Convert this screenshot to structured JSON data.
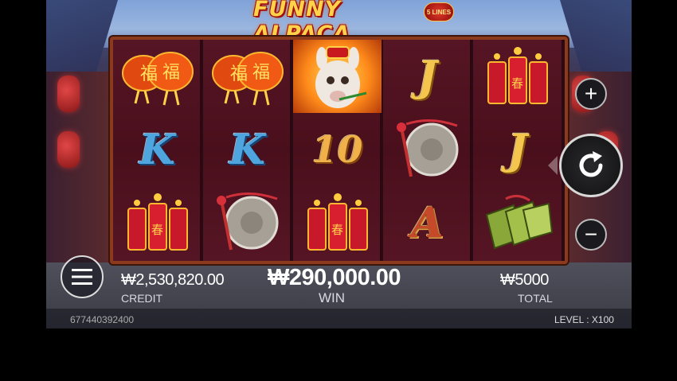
{
  "game": {
    "logo_text": "FUNNY ALPACA",
    "lines_badge": "5 LINES"
  },
  "reels": [
    [
      "lantern-fu",
      "letter-k",
      "firecrackers"
    ],
    [
      "lantern-fu",
      "letter-k",
      "gong"
    ],
    [
      "alpaca-wild",
      "number-10",
      "firecrackers"
    ],
    [
      "letter-j",
      "gong",
      "letter-a"
    ],
    [
      "firecrackers",
      "letter-j",
      "jade-tiles"
    ]
  ],
  "symbols": {
    "k_text": "K",
    "j_text": "J",
    "a_text": "A",
    "ten_text": "10",
    "fu_text": "福",
    "chun_text": "春"
  },
  "credit": {
    "value": "₩2,530,820.00",
    "caption": "CREDIT"
  },
  "win": {
    "value": "₩290,000.00",
    "caption": "WIN"
  },
  "total": {
    "value": "₩5000",
    "caption": "TOTAL"
  },
  "session_id": "677440392400",
  "level": "LEVEL : X100",
  "controls": {
    "plus": "+",
    "minus": "−",
    "menu_icon": "hamburger-icon",
    "spin_icon": "refresh-icon"
  },
  "colors": {
    "reel_bg": "#4a0f1c",
    "frame": "#8c3a1e",
    "logo_gold": "#ffd24a"
  }
}
